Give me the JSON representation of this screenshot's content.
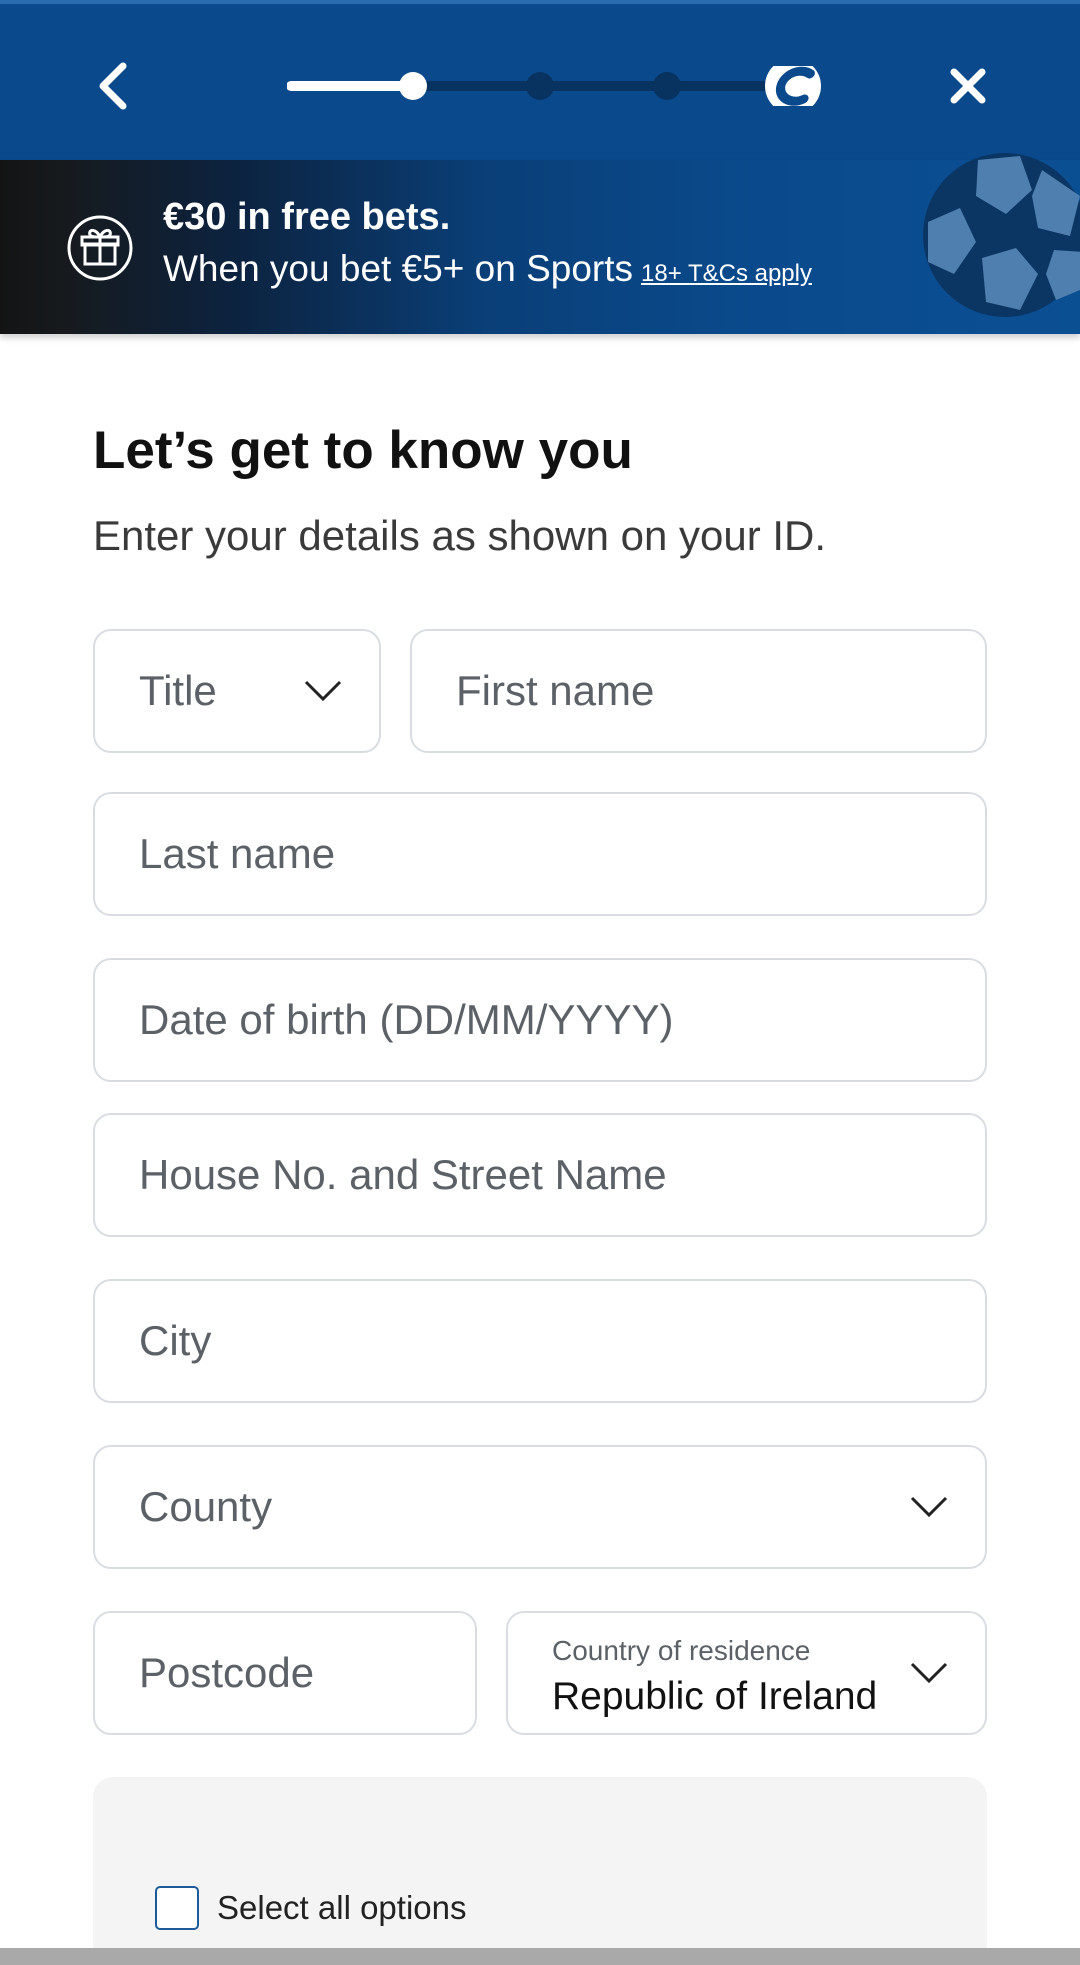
{
  "header": {
    "back_icon": "chevron-left-icon",
    "close_icon": "close-icon",
    "progress": {
      "current_step": 1,
      "total_steps": 4
    },
    "brand_icon": "coral-c-logo"
  },
  "promo": {
    "title": "€30 in free bets.",
    "line": "When you bet €5+ on Sports",
    "tc_link": "18+ T&Cs apply",
    "icon": "gift-icon",
    "image": "football-icon"
  },
  "form": {
    "heading": "Let’s get to know you",
    "subheading": "Enter your details as shown on your ID.",
    "title_select": "Title",
    "first_name_placeholder": "First name",
    "last_name_placeholder": "Last name",
    "dob_placeholder": "Date of birth (DD/MM/YYYY)",
    "street_placeholder": "House No. and Street Name",
    "city_placeholder": "City",
    "county_select": "County",
    "postcode_placeholder": "Postcode",
    "country_caption": "Country of residence",
    "country_value": "Republic of Ireland"
  },
  "consent": {
    "select_all_label": "Select all options",
    "checked": false
  },
  "colors": {
    "header_blue": "#0a4a8c",
    "checkbox_border": "#1c5a9a",
    "field_border": "#d9dde2"
  }
}
